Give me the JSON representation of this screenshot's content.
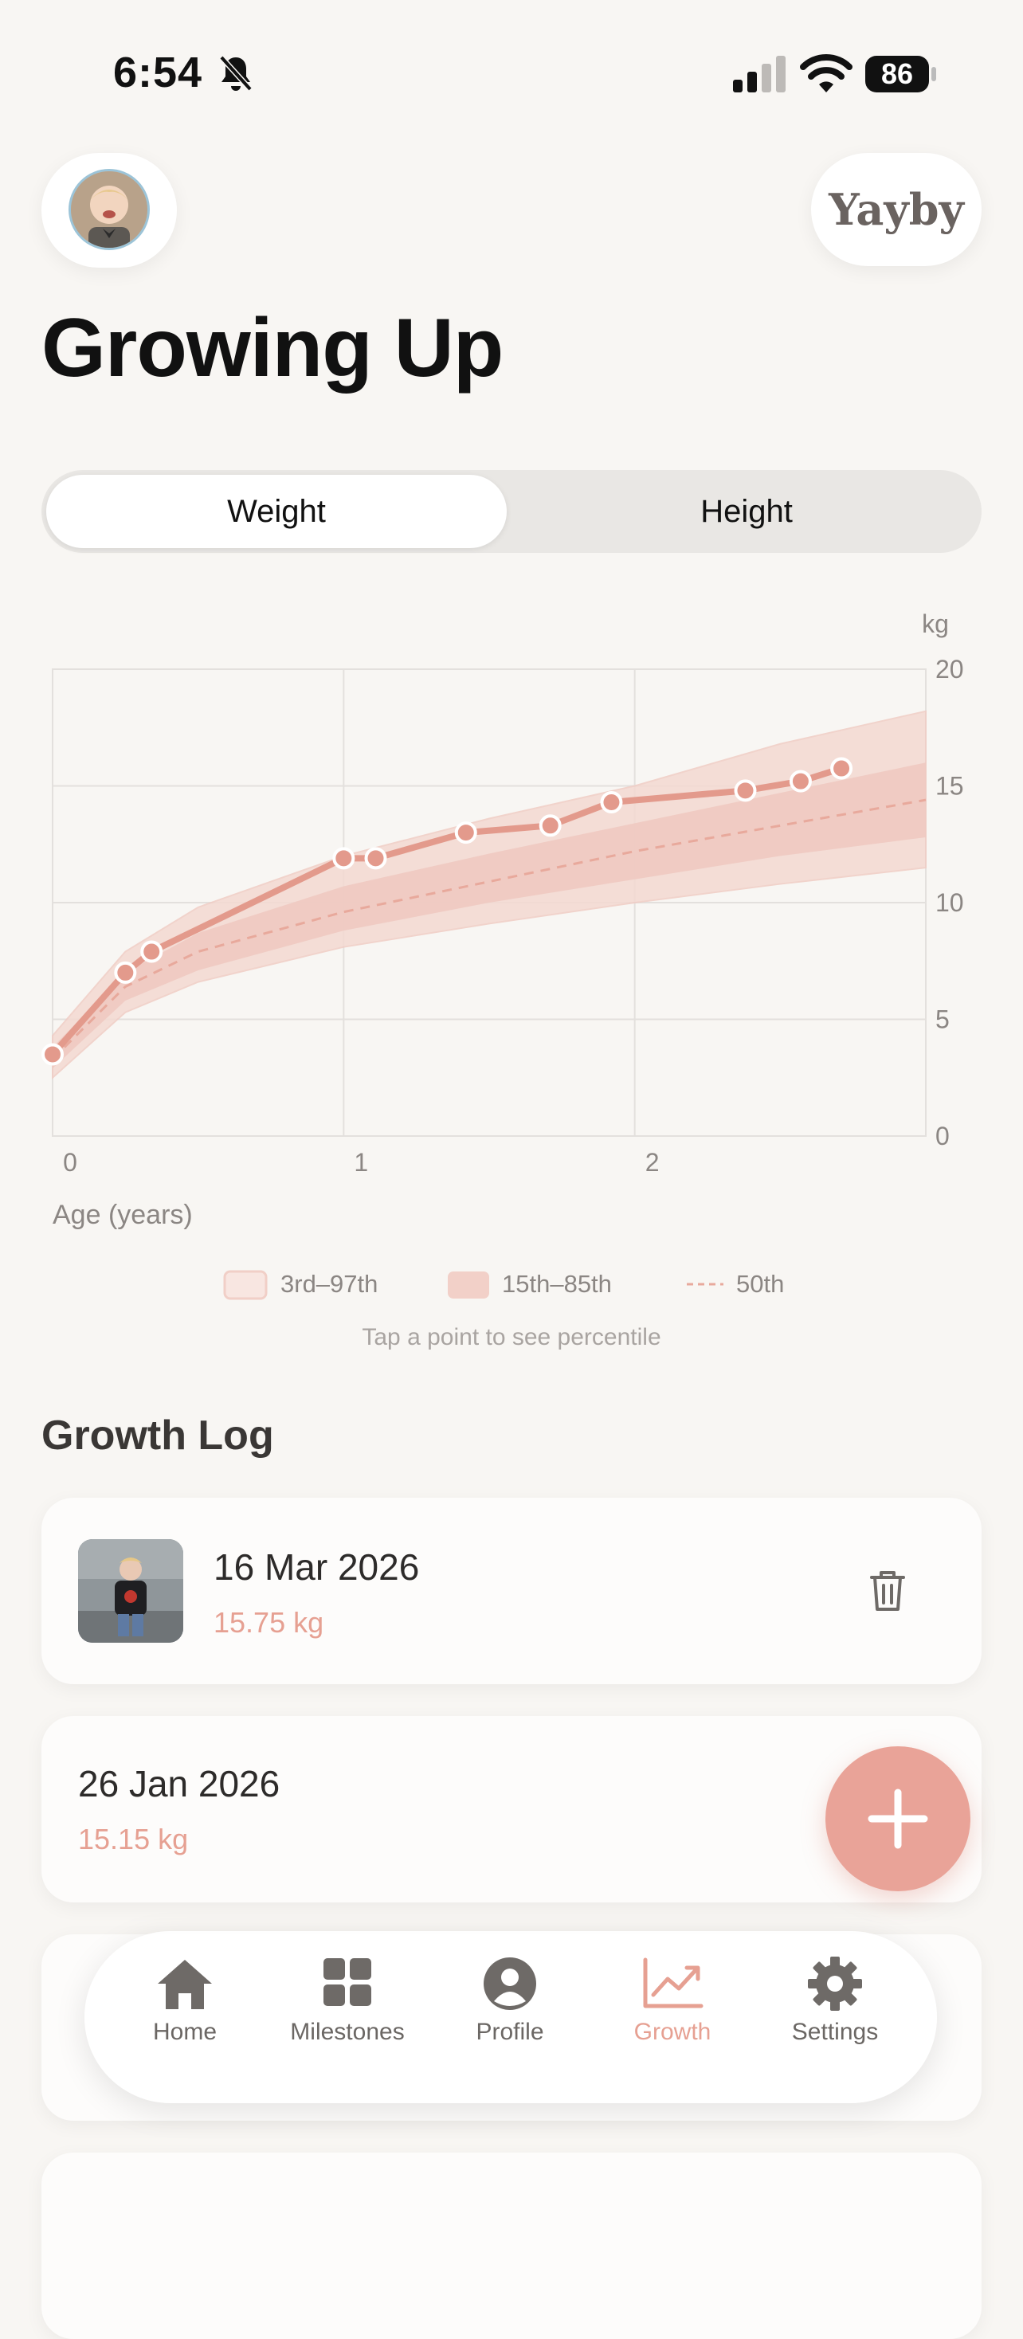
{
  "status_bar": {
    "time": "6:54",
    "battery": "86"
  },
  "header": {
    "brand": "Yayby",
    "title": "Growing Up"
  },
  "segmented": {
    "weight": "Weight",
    "height": "Height",
    "selected": "Weight"
  },
  "chart_data": {
    "type": "line",
    "y_unit": "kg",
    "xlabel": "Age (years)",
    "xlim": [
      0,
      3
    ],
    "ylim": [
      0,
      20
    ],
    "x_ticks": [
      "0",
      "1",
      "2"
    ],
    "y_ticks": [
      "0",
      "5",
      "10",
      "15",
      "20"
    ],
    "grid": true,
    "series": [
      {
        "name": "measurements",
        "x": [
          0.0,
          0.25,
          0.34,
          1.0,
          1.11,
          1.42,
          1.71,
          1.92,
          2.38,
          2.57,
          2.71
        ],
        "y": [
          3.5,
          7.0,
          7.9,
          11.9,
          11.9,
          13.0,
          13.3,
          14.3,
          14.8,
          15.2,
          15.75
        ]
      },
      {
        "name": "50th",
        "style": "dashed",
        "x": [
          0,
          0.25,
          0.5,
          1,
          1.5,
          2,
          2.5,
          3
        ],
        "y": [
          3.3,
          6.4,
          7.9,
          9.6,
          10.9,
          12.2,
          13.3,
          14.4
        ]
      }
    ],
    "bands": [
      {
        "name": "3rd–97th",
        "x": [
          0,
          0.25,
          0.5,
          1,
          1.5,
          2,
          2.5,
          3
        ],
        "low": [
          2.5,
          5.3,
          6.6,
          8.1,
          9.1,
          10.0,
          10.8,
          11.5
        ],
        "high": [
          4.3,
          7.9,
          9.8,
          12.0,
          13.6,
          15.0,
          16.8,
          18.2
        ]
      },
      {
        "name": "15th–85th",
        "x": [
          0,
          0.25,
          0.5,
          1,
          1.5,
          2,
          2.5,
          3
        ],
        "low": [
          2.9,
          5.8,
          7.1,
          8.8,
          10.0,
          11.0,
          12.0,
          12.8
        ],
        "high": [
          3.8,
          7.0,
          8.7,
          10.7,
          12.1,
          13.4,
          14.7,
          16.0
        ]
      }
    ],
    "legend": [
      "3rd–97th",
      "15th–85th",
      "50th"
    ],
    "legend_position": "bottom",
    "hint": "Tap a point to see percentile",
    "colors": {
      "line": "#e39a8c",
      "band_outer": "#f4d9d2",
      "band_inner": "#efc8bf",
      "median": "#e8a99c",
      "grid": "#e3e0dd"
    }
  },
  "growth_log": {
    "title": "Growth Log",
    "entries": [
      {
        "date": "16 Mar 2026",
        "weight": "15.75 kg"
      },
      {
        "date": "26 Jan 2026",
        "weight": "15.15 kg"
      }
    ]
  },
  "tabbar": {
    "items": [
      {
        "label": "Home",
        "icon": "home-icon"
      },
      {
        "label": "Milestones",
        "icon": "grid-icon"
      },
      {
        "label": "Profile",
        "icon": "person-icon"
      },
      {
        "label": "Growth",
        "icon": "chart-icon"
      },
      {
        "label": "Settings",
        "icon": "gear-icon"
      }
    ],
    "active": "Growth"
  },
  "accent": "#e9a398"
}
